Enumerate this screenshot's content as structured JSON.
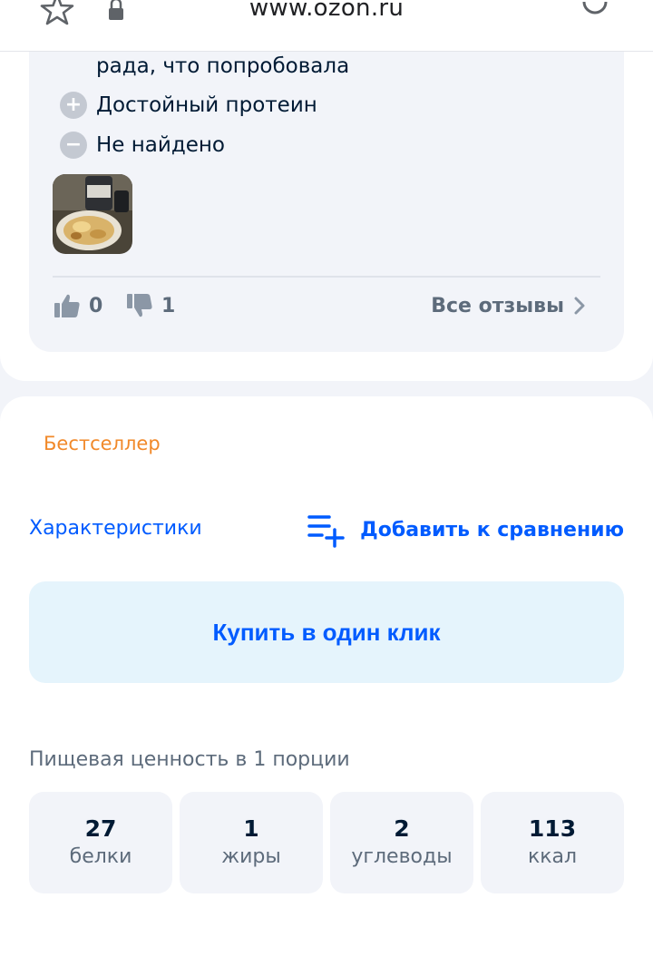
{
  "browser": {
    "url": "www.ozon.ru",
    "icons": [
      "star-icon",
      "lock-icon",
      "reload-icon"
    ]
  },
  "review": {
    "text_tail": "рада, что попробовала",
    "pros_label": "Достойный протеин",
    "cons_label": "Не найдено",
    "likes": "0",
    "dislikes": "1",
    "all_reviews_label": "Все отзывы"
  },
  "product": {
    "badge": "Бестселлер",
    "characteristics_link": "Характеристики",
    "compare_label": "Добавить к сравнению",
    "buy_one_click_label": "Купить в один клик",
    "nutrition_title": "Пищевая ценность в 1 порции",
    "nutrition": [
      {
        "value": "27",
        "label": "белки"
      },
      {
        "value": "1",
        "label": "жиры"
      },
      {
        "value": "2",
        "label": "углеводы"
      },
      {
        "value": "113",
        "label": "ккал"
      }
    ]
  },
  "colors": {
    "accent": "#005bff",
    "badge": "#f1892a",
    "card_bg": "#f2f4f9",
    "buy_bg": "#e5f4fc"
  }
}
